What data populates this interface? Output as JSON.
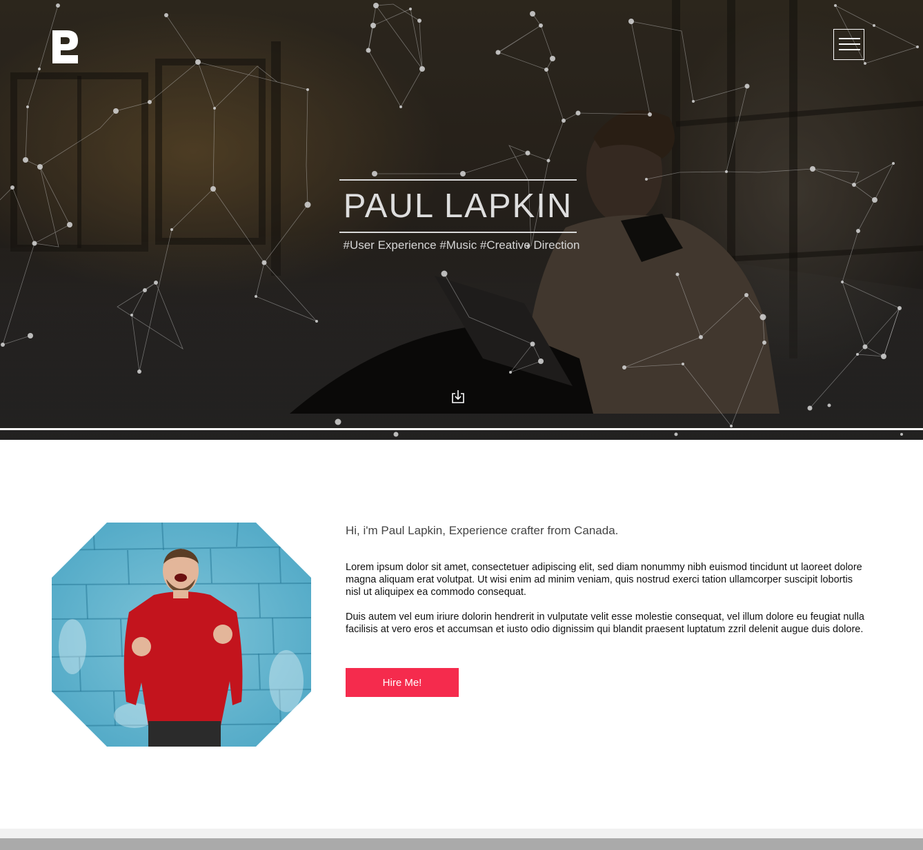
{
  "header": {
    "logo_icon": "p-logo-icon",
    "menu_icon": "hamburger-menu-icon"
  },
  "hero": {
    "title": "PAUL LAPKIN",
    "subtitle": "#User Experience #Music #Creative Direction",
    "scroll_icon": "download-arrow-icon"
  },
  "about": {
    "heading": "Hi, i'm Paul Lapkin, Experience crafter from Canada.",
    "paragraph_1": "Lorem ipsum dolor sit amet, consectetuer adipiscing elit, sed diam nonummy nibh euismod tincidunt ut laoreet dolore magna aliquam erat volutpat. Ut wisi enim ad minim veniam, quis nostrud exerci tation ullamcorper suscipit lobortis nisl ut aliquipex ea commodo consequat.",
    "paragraph_2": "Duis autem vel eum iriure dolorin hendrerit in vulputate velit esse molestie consequat, vel illum dolore eu feugiat nulla facilisis at vero eros et accumsan et iusto odio dignissim qui blandit praesent luptatum zzril delenit augue duis dolore.",
    "hire_label": "Hire Me!"
  },
  "colors": {
    "accent": "#f52b4d",
    "hero_text": "#dedede"
  }
}
